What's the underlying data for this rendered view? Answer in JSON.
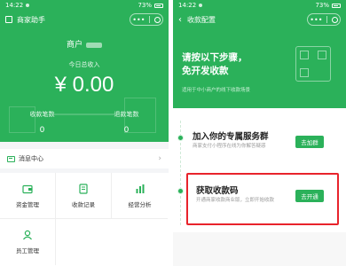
{
  "left": {
    "status": {
      "time": "14:22",
      "battery": "73%"
    },
    "title": "商家助手",
    "merchant_label": "商户",
    "income_label": "今日总收入",
    "income_value": "¥ 0.00",
    "stats": [
      {
        "label": "收款笔数",
        "value": "0"
      },
      {
        "label": "退款笔数",
        "value": "0"
      }
    ],
    "message_center": "消息中心",
    "grid": [
      {
        "label": "资金管理",
        "icon": "wallet-icon"
      },
      {
        "label": "收款记录",
        "icon": "record-icon"
      },
      {
        "label": "经营分析",
        "icon": "chart-icon"
      },
      {
        "label": "员工管理",
        "icon": "user-icon"
      }
    ]
  },
  "right": {
    "status": {
      "time": "14:22",
      "battery": "73%"
    },
    "title": "收款配置",
    "hero_line1": "请按以下步骤，",
    "hero_line2": "免开发收款",
    "hero_sub": "适用于中小商户的线下收款场景",
    "steps": [
      {
        "title": "加入你的专属服务群",
        "sub": "商家支付小程序在线为你解答疑惑",
        "button": "去加群"
      },
      {
        "title": "获取收款码",
        "sub": "开通商家收款商业版，立即开始收款",
        "button": "去开通"
      }
    ]
  },
  "colors": {
    "brand_green": "#2bb15a",
    "highlight_red": "#e8232b"
  }
}
